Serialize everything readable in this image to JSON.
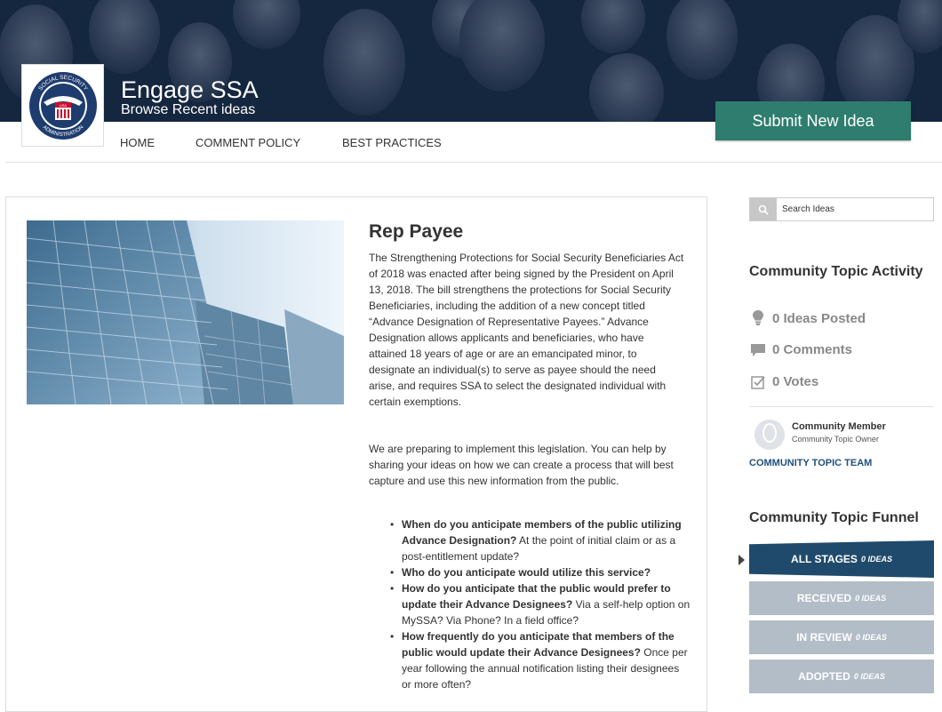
{
  "header": {
    "title": "Engage SSA",
    "subtitle": "Browse Recent ideas",
    "logo_text": [
      "SOCIAL SECURITY",
      "ADMINISTRATION",
      "USA"
    ],
    "submit_label": "Submit New Idea"
  },
  "nav": {
    "items": [
      {
        "label": "HOME"
      },
      {
        "label": "COMMENT POLICY"
      },
      {
        "label": "BEST PRACTICES"
      }
    ]
  },
  "topic": {
    "title": "Rep Payee",
    "paragraph1": "The Strengthening Protections for Social Security Beneficiaries Act of 2018 was enacted after being signed by the President on April 13, 2018. The bill strengthens the protections for Social Security Beneficiaries, including the addition of a new concept titled “Advance Designation of Representative Payees.” Advance Designation allows applicants and beneficiaries, who have attained 18 years of age or are an emancipated minor, to designate an individual(s) to serve as payee should the need arise, and requires SSA to select the designated individual with certain exemptions.",
    "paragraph2": "We are preparing to implement this legislation. You can help by sharing your ideas on how we can create a process that will best capture and use this new information from the public.",
    "questions": [
      {
        "bold": "When do you anticipate members of the public utilizing Advance Designation?",
        "rest": " At the point of initial claim or as a post-entitlement update?"
      },
      {
        "bold": "Who do you anticipate would utilize this service?",
        "rest": ""
      },
      {
        "bold": "How do you anticipate that the public would prefer to update their Advance Designees?",
        "rest": " Via a self-help option on MySSA? Via Phone? In a field office?"
      },
      {
        "bold": "How frequently do you anticipate that members of the public would update their Advance Designees?",
        "rest": " Once per year following the annual notification listing their designees or more often?"
      }
    ]
  },
  "sidebar": {
    "search_placeholder": "Search Ideas",
    "activity_title": "Community Topic Activity",
    "stats": [
      {
        "icon": "lightbulb-icon",
        "label": "0 Ideas Posted"
      },
      {
        "icon": "comment-icon",
        "label": "0 Comments"
      },
      {
        "icon": "checkbox-icon",
        "label": "0 Votes"
      }
    ],
    "member": {
      "name": "Community Member",
      "role": "Community Topic Owner"
    },
    "team_link": "COMMUNITY TOPIC TEAM",
    "funnel_title": "Community Topic Funnel",
    "stages": [
      {
        "label": "ALL STAGES",
        "count": "0 IDEAS",
        "color": "#1f4a6b",
        "active": true
      },
      {
        "label": "RECEIVED",
        "count": "0 IDEAS",
        "color": "#b3bdc7",
        "active": false
      },
      {
        "label": "IN REVIEW",
        "count": "0 IDEAS",
        "color": "#b3bdc7",
        "active": false
      },
      {
        "label": "ADOPTED",
        "count": "0 IDEAS",
        "color": "#b3bdc7",
        "active": false
      }
    ]
  },
  "colors": {
    "brand_green": "#2e7d6e",
    "funnel_active": "#1f4a6b",
    "funnel_inactive": "#b3bdc7",
    "link_blue": "#1f4f7d"
  }
}
